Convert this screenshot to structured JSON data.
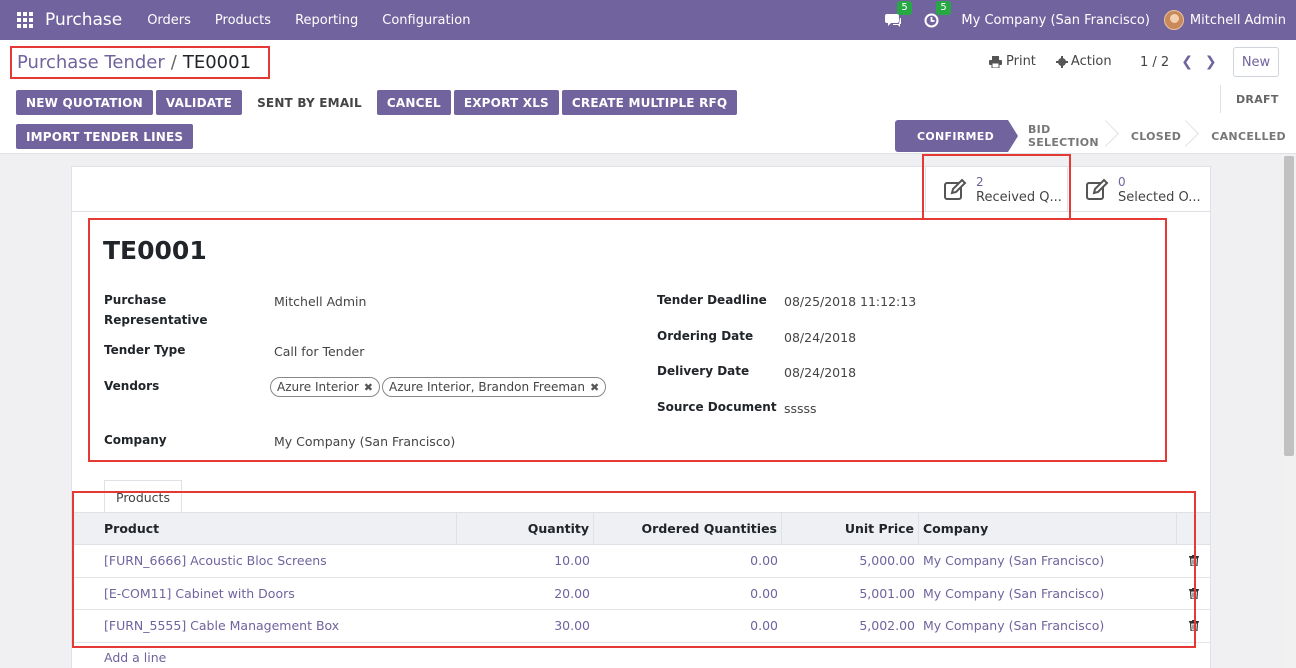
{
  "navbar": {
    "app_name": "Purchase",
    "menu": [
      "Orders",
      "Products",
      "Reporting",
      "Configuration"
    ],
    "messages_count": "5",
    "activities_count": "5",
    "company": "My Company (San Francisco)",
    "user": "Mitchell Admin"
  },
  "breadcrumb": {
    "parent": "Purchase Tender",
    "separator": "/",
    "current": "TE0001"
  },
  "control": {
    "print_label": "Print",
    "action_label": "Action",
    "pager": "1 / 2",
    "new_label": "New"
  },
  "header_buttons": {
    "new_quotation": "NEW QUOTATION",
    "validate": "VALIDATE",
    "sent_by_email": "SENT BY EMAIL",
    "cancel": "CANCEL",
    "export_xls": "EXPORT XLS",
    "create_multiple_rfq": "CREATE MULTIPLE RFQ",
    "import_tender_lines": "IMPORT TENDER LINES",
    "draft": "DRAFT"
  },
  "statusbar": [
    "CONFIRMED",
    "BID SELECTION",
    "CLOSED",
    "CANCELLED"
  ],
  "smart_buttons": {
    "received": {
      "value": "2",
      "label": "Received Q..."
    },
    "selected": {
      "value": "0",
      "label": "Selected O..."
    }
  },
  "form": {
    "title": "TE0001",
    "purchase_rep_label_1": "Purchase",
    "purchase_rep_label_2": "Representative",
    "purchase_rep": "Mitchell Admin",
    "tender_type_label": "Tender Type",
    "tender_type": "Call for Tender",
    "vendors_label": "Vendors",
    "vendors": [
      "Azure Interior",
      "Azure Interior, Brandon Freeman"
    ],
    "company_label": "Company",
    "company": "My Company (San Francisco)",
    "deadline_label": "Tender Deadline",
    "deadline": "08/25/2018 11:12:13",
    "ordering_date_label": "Ordering Date",
    "ordering_date": "08/24/2018",
    "delivery_date_label": "Delivery Date",
    "delivery_date": "08/24/2018",
    "source_doc_label": "Source Document",
    "source_doc": "sssss"
  },
  "notebook": {
    "tab_products": "Products",
    "columns": {
      "product": "Product",
      "quantity": "Quantity",
      "ordered": "Ordered Quantities",
      "unit_price": "Unit Price",
      "company": "Company"
    },
    "rows": [
      {
        "product": "[FURN_6666] Acoustic Bloc Screens",
        "quantity": "10.00",
        "ordered": "0.00",
        "unit_price": "5,000.00",
        "company": "My Company (San Francisco)"
      },
      {
        "product": "[E-COM11] Cabinet with Doors",
        "quantity": "20.00",
        "ordered": "0.00",
        "unit_price": "5,001.00",
        "company": "My Company (San Francisco)"
      },
      {
        "product": "[FURN_5555] Cable Management Box",
        "quantity": "30.00",
        "ordered": "0.00",
        "unit_price": "5,002.00",
        "company": "My Company (San Francisco)"
      }
    ],
    "add_line": "Add a line"
  }
}
